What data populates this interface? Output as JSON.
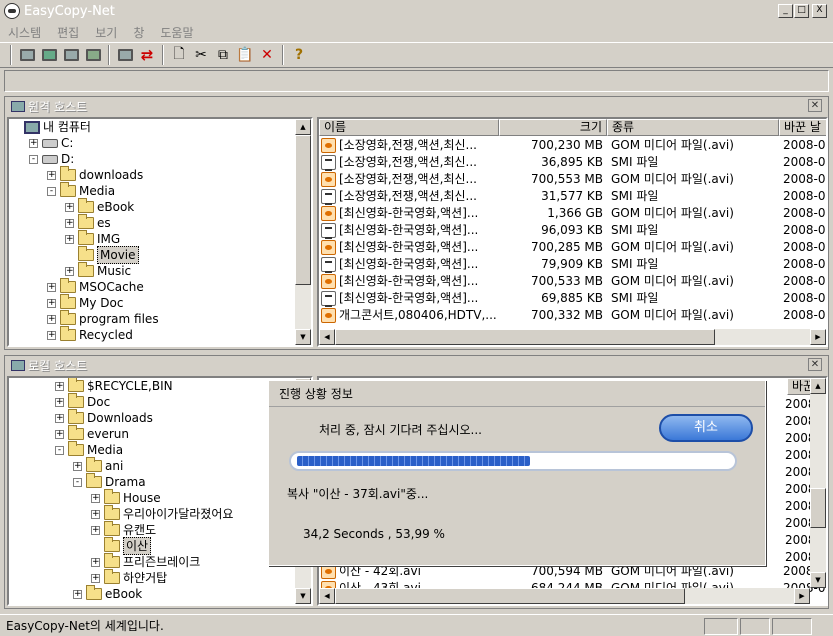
{
  "window": {
    "title": "EasyCopy-Net",
    "min": "_",
    "max": "□",
    "close": "X"
  },
  "menu": [
    "시스템",
    "편집",
    "보기",
    "창",
    "도움말"
  ],
  "toolbar_icons": [
    "monitor-icon",
    "monitor-icon",
    "monitor-icon",
    "monitor-icon",
    "monitor-icon",
    "transfer-arrows-icon",
    "new-document-icon",
    "cut-icon",
    "copy-icon",
    "paste-icon",
    "delete-icon",
    "help-icon"
  ],
  "remote": {
    "title": "원격 호스트",
    "tree": [
      {
        "label": "내 컴퓨터",
        "icon": "pc",
        "level": 0,
        "expander": ""
      },
      {
        "label": "C:",
        "icon": "drive",
        "level": 1,
        "expander": "+"
      },
      {
        "label": "D:",
        "icon": "drive",
        "level": 1,
        "expander": "-"
      },
      {
        "label": "downloads",
        "icon": "folder",
        "level": 2,
        "expander": "+"
      },
      {
        "label": "Media",
        "icon": "folder",
        "level": 2,
        "expander": "-"
      },
      {
        "label": "eBook",
        "icon": "folder",
        "level": 3,
        "expander": "+"
      },
      {
        "label": "es",
        "icon": "folder",
        "level": 3,
        "expander": "+"
      },
      {
        "label": "IMG",
        "icon": "folder",
        "level": 3,
        "expander": "+"
      },
      {
        "label": "Movie",
        "icon": "folder",
        "level": 3,
        "expander": "",
        "selected": true
      },
      {
        "label": "Music",
        "icon": "folder",
        "level": 3,
        "expander": "+"
      },
      {
        "label": "MSOCache",
        "icon": "folder",
        "level": 2,
        "expander": "+"
      },
      {
        "label": "My Doc",
        "icon": "folder",
        "level": 2,
        "expander": "+"
      },
      {
        "label": "program files",
        "icon": "folder",
        "level": 2,
        "expander": "+"
      },
      {
        "label": "Recycled",
        "icon": "folder",
        "level": 2,
        "expander": "+"
      }
    ],
    "columns": [
      "이름",
      "크기",
      "종류",
      "바꾼 날"
    ],
    "files": [
      {
        "name": "[소장영화,전쟁,액션,최신...",
        "size": "700,230 MB",
        "type": "GOM 미디어 파일(.avi)",
        "date": "2008-0",
        "icon": "avi"
      },
      {
        "name": "[소장영화,전쟁,액션,최신...",
        "size": "36,895 KB",
        "type": "SMI 파일",
        "date": "2008-0",
        "icon": "smi"
      },
      {
        "name": "[소장영화,전쟁,액션,최신...",
        "size": "700,553 MB",
        "type": "GOM 미디어 파일(.avi)",
        "date": "2008-0",
        "icon": "avi"
      },
      {
        "name": "[소장영화,전쟁,액션,최신...",
        "size": "31,577 KB",
        "type": "SMI 파일",
        "date": "2008-0",
        "icon": "smi"
      },
      {
        "name": "[최신영화-한국영화,액션]...",
        "size": "1,366 GB",
        "type": "GOM 미디어 파일(.avi)",
        "date": "2008-0",
        "icon": "avi"
      },
      {
        "name": "[최신영화-한국영화,액션]...",
        "size": "96,093 KB",
        "type": "SMI 파일",
        "date": "2008-0",
        "icon": "smi"
      },
      {
        "name": "[최신영화-한국영화,액션]...",
        "size": "700,285 MB",
        "type": "GOM 미디어 파일(.avi)",
        "date": "2008-0",
        "icon": "avi"
      },
      {
        "name": "[최신영화-한국영화,액션]...",
        "size": "79,909 KB",
        "type": "SMI 파일",
        "date": "2008-0",
        "icon": "smi"
      },
      {
        "name": "[최신영화-한국영화,액션]...",
        "size": "700,533 MB",
        "type": "GOM 미디어 파일(.avi)",
        "date": "2008-0",
        "icon": "avi"
      },
      {
        "name": "[최신영화-한국영화,액션]...",
        "size": "69,885 KB",
        "type": "SMI 파일",
        "date": "2008-0",
        "icon": "smi"
      },
      {
        "name": "개그콘서트,080406,HDTV,...",
        "size": "700,332 MB",
        "type": "GOM 미디어 파일(.avi)",
        "date": "2008-0",
        "icon": "avi"
      }
    ]
  },
  "local": {
    "title": "로컬 호스트",
    "tree": [
      {
        "label": "$RECYCLE,BIN",
        "icon": "folder",
        "level": 2,
        "expander": "+"
      },
      {
        "label": "Doc",
        "icon": "folder",
        "level": 2,
        "expander": "+"
      },
      {
        "label": "Downloads",
        "icon": "folder",
        "level": 2,
        "expander": "+"
      },
      {
        "label": "everun",
        "icon": "folder",
        "level": 2,
        "expander": "+"
      },
      {
        "label": "Media",
        "icon": "folder",
        "level": 2,
        "expander": "-"
      },
      {
        "label": "ani",
        "icon": "folder",
        "level": 3,
        "expander": "+"
      },
      {
        "label": "Drama",
        "icon": "folder",
        "level": 3,
        "expander": "-"
      },
      {
        "label": "House",
        "icon": "folder",
        "level": 4,
        "expander": "+"
      },
      {
        "label": "우리아이가달라졌어요",
        "icon": "folder",
        "level": 4,
        "expander": "+"
      },
      {
        "label": "유캔도",
        "icon": "folder",
        "level": 4,
        "expander": "+"
      },
      {
        "label": "이산",
        "icon": "folder",
        "level": 4,
        "expander": "",
        "selected": true
      },
      {
        "label": "프리즌브레이크",
        "icon": "folder",
        "level": 4,
        "expander": "+"
      },
      {
        "label": "하얀거탑",
        "icon": "folder",
        "level": 4,
        "expander": "+"
      },
      {
        "label": "eBook",
        "icon": "folder",
        "level": 3,
        "expander": "+"
      }
    ],
    "col_date": "바꾼",
    "dates": [
      "2008",
      "2008",
      "2008",
      "2008",
      "2008",
      "2008",
      "2008",
      "2008",
      "2008",
      "2008"
    ],
    "files": [
      {
        "name": "이산 - 42회.avi",
        "size": "700,594 MB",
        "type": "GOM 미디어 파일(.avi)",
        "date": "2008-0"
      },
      {
        "name": "이산 - 43회.avi",
        "size": "684,244 MB",
        "type": "GOM 미디어 파일(.avi)",
        "date": "2008-0"
      }
    ]
  },
  "progress": {
    "title": "진행 상황 정보",
    "message": "처리 중, 잠시 기다려 주십시오...",
    "cancel": "취소",
    "copying": "복사 \"이산 - 37회.avi\"중...",
    "stats": "34,2 Seconds , 53,99 %",
    "fraction": 0.54
  },
  "status": {
    "text": "EasyCopy-Net의 세계입니다."
  }
}
